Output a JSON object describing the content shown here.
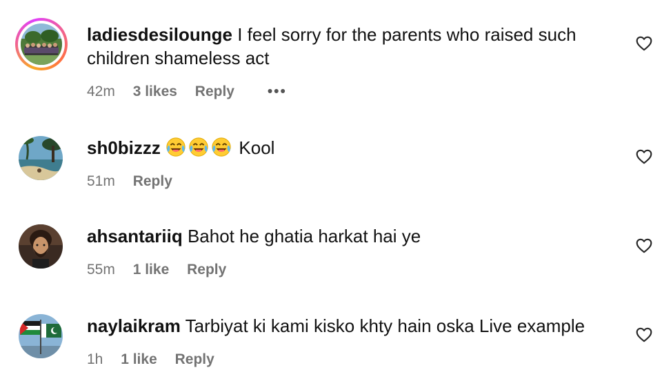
{
  "comments": [
    {
      "username": "ladiesdesilounge",
      "text": "I feel sorry for the parents who raised such children shameless act",
      "time": "42m",
      "likes": "3 likes",
      "reply": "Reply",
      "more": "•••",
      "avatar_story_ring": true
    },
    {
      "username": "sh0bizzz",
      "emojis": [
        "face-with-tears-of-joy",
        "face-with-tears-of-joy",
        "face-with-tears-of-joy"
      ],
      "text": "Kool",
      "time": "51m",
      "reply": "Reply"
    },
    {
      "username": "ahsantariiq",
      "text": "Bahot he ghatia harkat hai ye",
      "time": "55m",
      "likes": "1 like",
      "reply": "Reply"
    },
    {
      "username": "naylaikram",
      "text": "Tarbiyat ki kami kisko khty hain oska Live example",
      "time": "1h",
      "likes": "1 like",
      "reply": "Reply"
    }
  ],
  "icons": {
    "like": "heart-outline-icon",
    "more": "more-dots-icon",
    "emoji": "face-with-tears-of-joy"
  },
  "colors": {
    "text": "#111111",
    "meta": "#737373",
    "ring_start": "#f9a825",
    "ring_end": "#e040fb"
  }
}
